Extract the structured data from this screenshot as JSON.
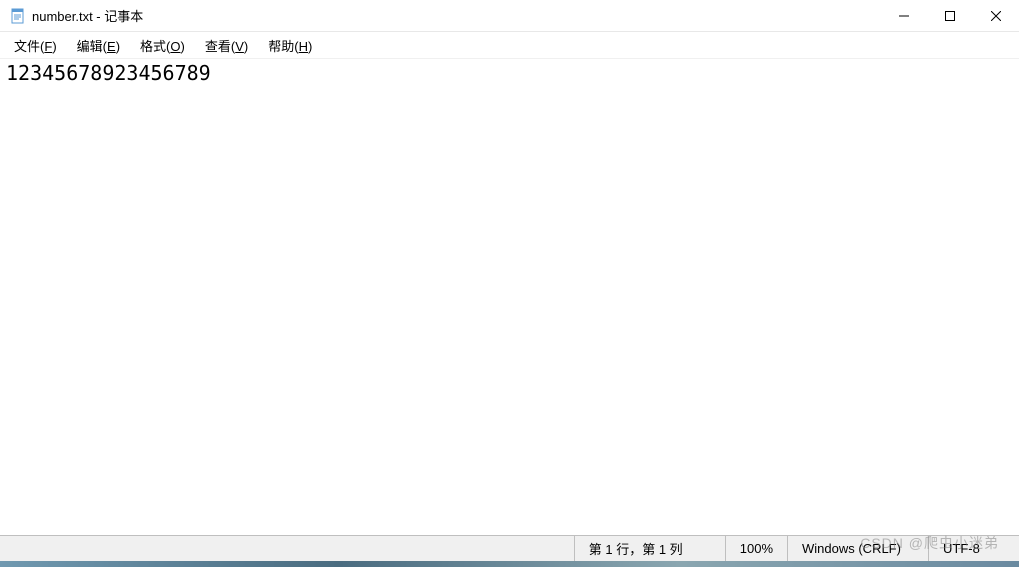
{
  "titlebar": {
    "title": "number.txt - 记事本"
  },
  "menu": {
    "file": {
      "label": "文件",
      "key": "F"
    },
    "edit": {
      "label": "编辑",
      "key": "E"
    },
    "format": {
      "label": "格式",
      "key": "O"
    },
    "view": {
      "label": "查看",
      "key": "V"
    },
    "help": {
      "label": "帮助",
      "key": "H"
    }
  },
  "editor": {
    "content": "12345678923456789"
  },
  "statusbar": {
    "position": "第 1 行，第 1 列",
    "zoom": "100%",
    "line_ending": "Windows (CRLF)",
    "encoding": "UTF-8"
  },
  "watermark": "CSDN @爬虫小迷弟"
}
